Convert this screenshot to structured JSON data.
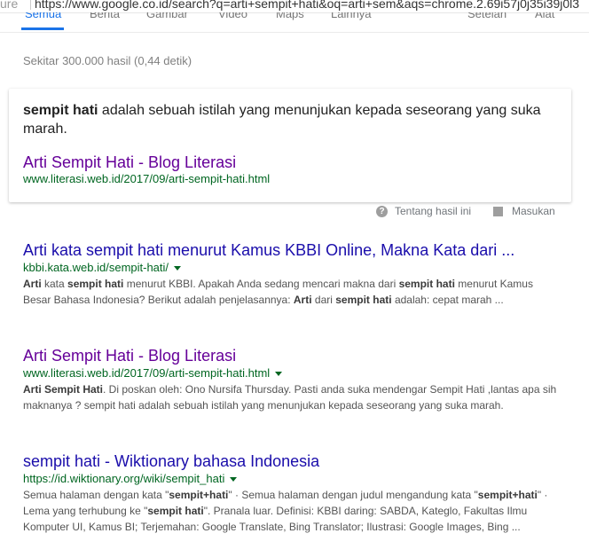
{
  "address_bar": {
    "prefix": "ure",
    "url": "https://www.google.co.id/search?q=arti+sempit+hati&oq=arti+sem&aqs=chrome.2.69i57j0j35i39j0l3"
  },
  "tabs": [
    {
      "label": "Semua",
      "active": true
    },
    {
      "label": "Berita"
    },
    {
      "label": "Gambar"
    },
    {
      "label": "Video"
    },
    {
      "label": "Maps"
    },
    {
      "label": "Lainnya"
    },
    {
      "label": "Setelan"
    },
    {
      "label": "Alat"
    }
  ],
  "result_stats": "Sekitar 300.000 hasil (0,44 detik)",
  "featured_snippet": {
    "text_bold": "sempit hati",
    "text_rest": " adalah sebuah istilah yang menunjukan kepada seseorang yang suka marah.",
    "title": "Arti Sempit Hati - Blog Literasi",
    "url": "www.literasi.web.id/2017/09/arti-sempit-hati.html",
    "about_label": "Tentang hasil ini",
    "feedback_label": "Masukan"
  },
  "results": [
    {
      "title": "Arti kata sempit hati menurut Kamus KBBI Online, Makna Kata dari ...",
      "url": "kbbi.kata.web.id/sempit-hati/",
      "description": [
        {
          "t": "Arti",
          "b": true
        },
        {
          "t": " kata "
        },
        {
          "t": "sempit hati",
          "b": true
        },
        {
          "t": " menurut KBBI. Apakah Anda sedang mencari makna dari "
        },
        {
          "t": "sempit hati",
          "b": true
        },
        {
          "t": " menurut Kamus Besar Bahasa Indonesia? Berikut adalah penjelasannya: "
        },
        {
          "t": "Arti",
          "b": true
        },
        {
          "t": " dari "
        },
        {
          "t": "sempit hati",
          "b": true
        },
        {
          "t": " adalah: cepat marah ..."
        }
      ]
    },
    {
      "title": "Arti Sempit Hati - Blog Literasi",
      "url": "www.literasi.web.id/2017/09/arti-sempit-hati.html",
      "visited": true,
      "description": [
        {
          "t": "Arti Sempit Hati",
          "b": true
        },
        {
          "t": ". Di poskan oleh: Ono Nursifa Thursday. Pasti anda suka mendengar Sempit Hati ,lantas apa sih maknanya ? sempit hati adalah sebuah istilah yang menunjukan kepada seseorang yang suka marah."
        }
      ]
    },
    {
      "title": "sempit hati - Wiktionary bahasa Indonesia",
      "url": "https://id.wiktionary.org/wiki/sempit_hati",
      "description": [
        {
          "t": "Semua halaman dengan kata \""
        },
        {
          "t": "sempit+hati",
          "b": true
        },
        {
          "t": "\" · Semua halaman dengan judul mengandung kata \""
        },
        {
          "t": "sempit+hati",
          "b": true
        },
        {
          "t": "\" · Lema yang terhubung ke \""
        },
        {
          "t": "sempit hati",
          "b": true
        },
        {
          "t": "\". Pranala luar. Definisi: KBBI daring: SABDA, Kateglo, Fakultas Ilmu Komputer UI, Kamus BI; Terjemahan: Google Translate, Bing Translator; Ilustrasi: Google Images, Bing ..."
        }
      ]
    }
  ]
}
